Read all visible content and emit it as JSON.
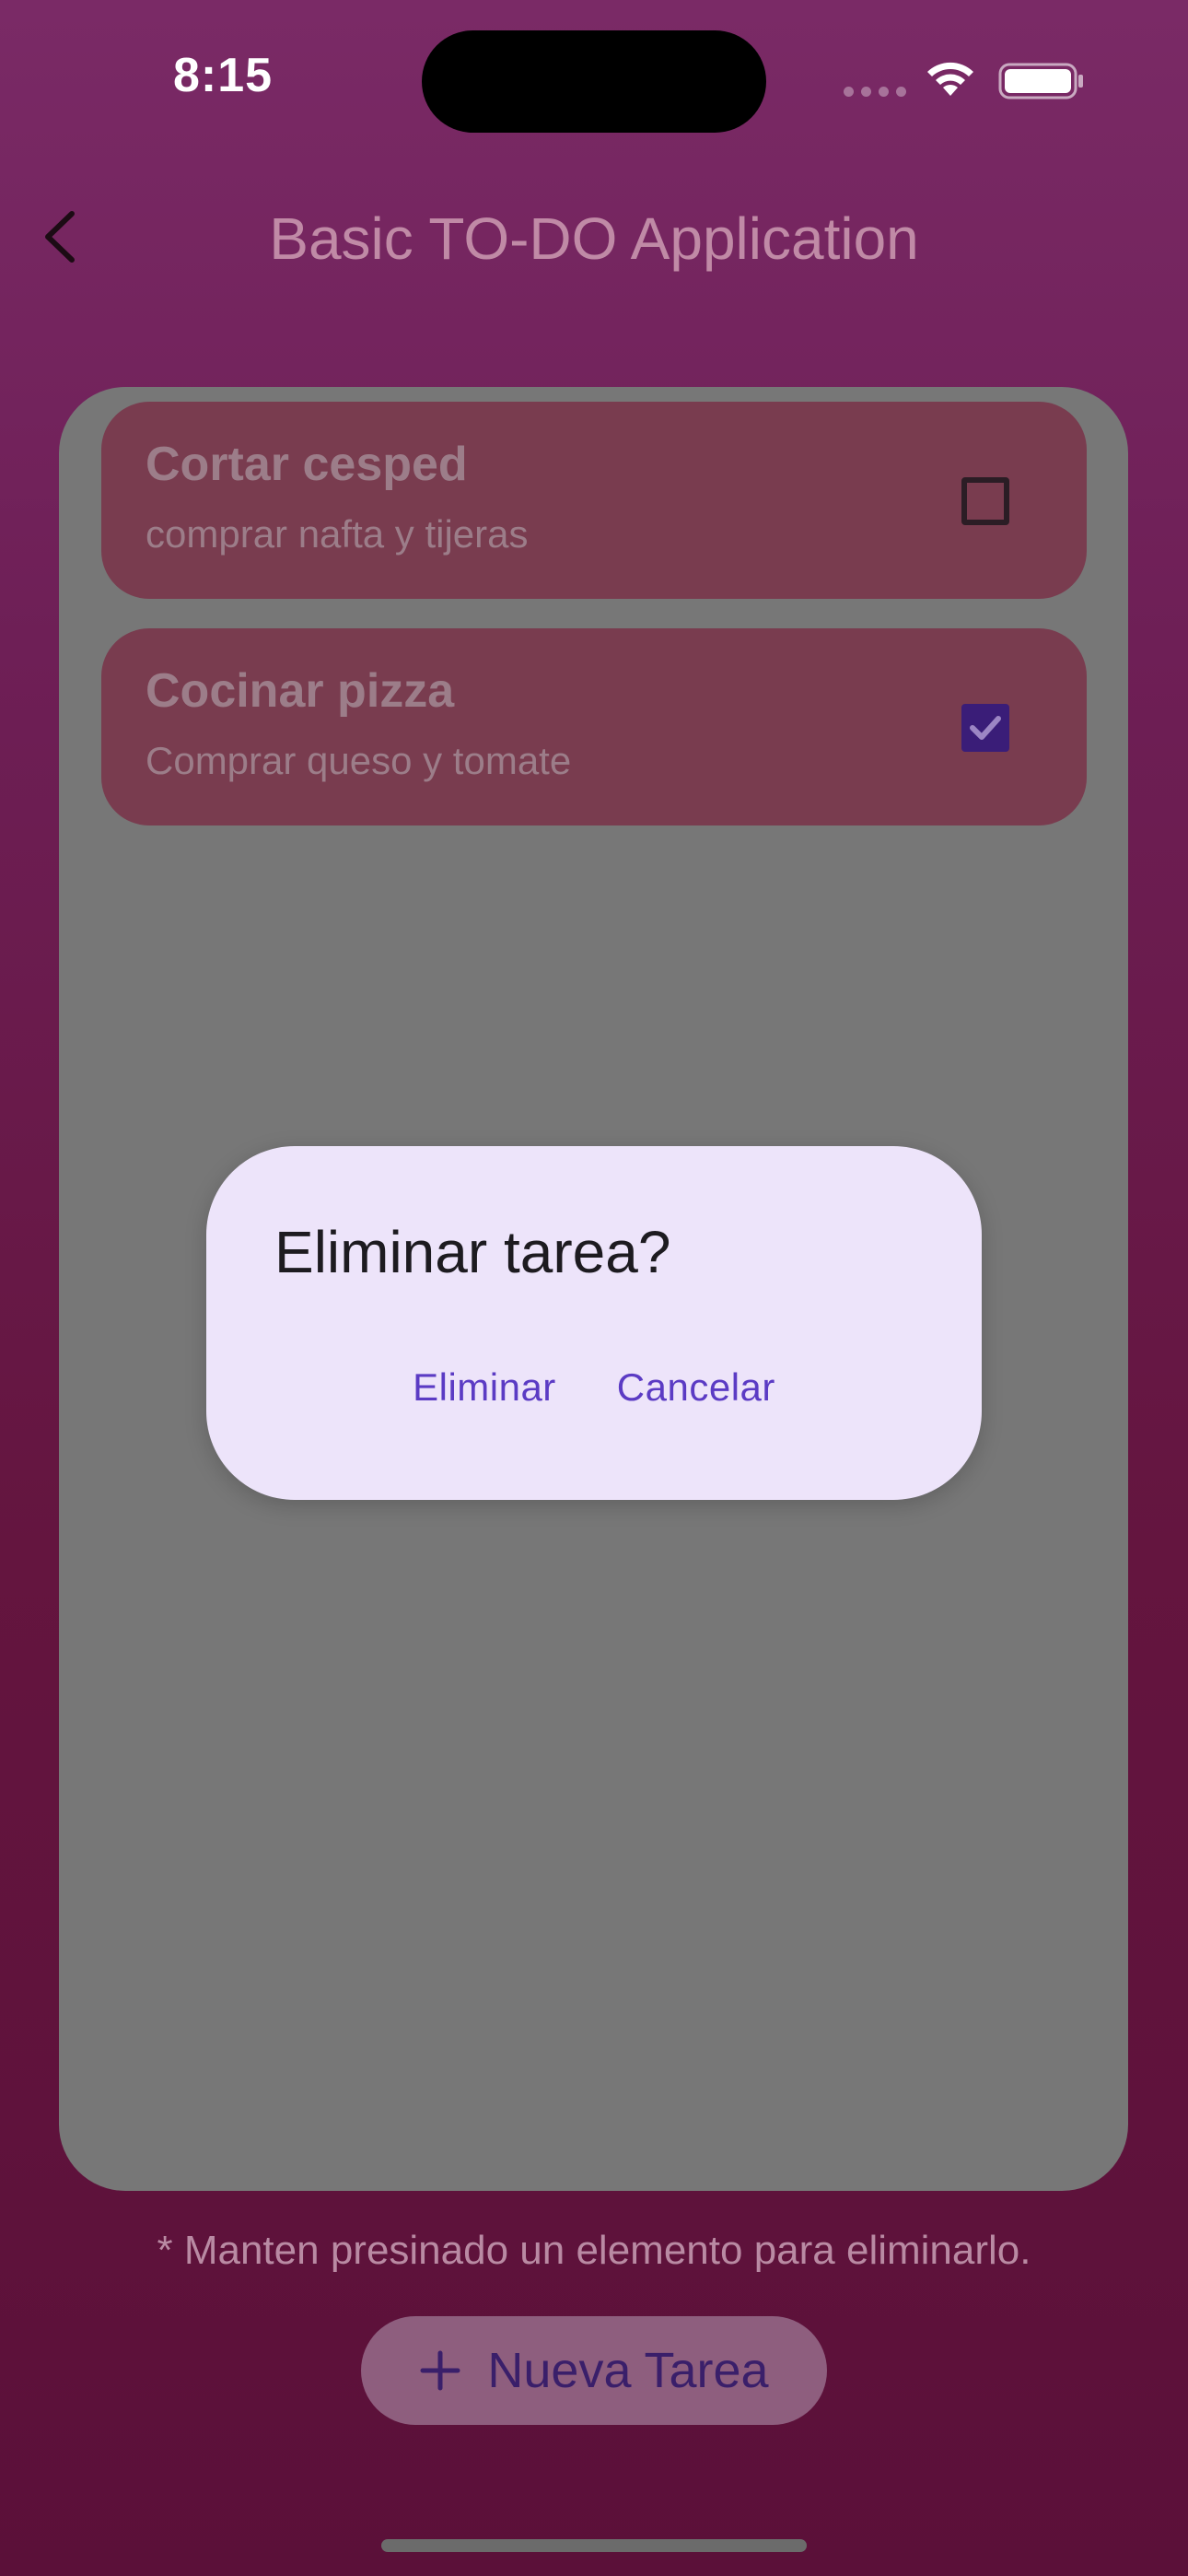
{
  "status_bar": {
    "time": "8:15"
  },
  "app_bar": {
    "title": "Basic TO-DO Application",
    "back_icon": "chevron-left-icon"
  },
  "tasks": [
    {
      "title": "Cortar cesped",
      "description": "comprar nafta y tijeras",
      "done": false
    },
    {
      "title": "Cocinar pizza",
      "description": "Comprar queso y tomate",
      "done": true
    }
  ],
  "hint": "* Manten presinado un elemento para eliminarlo.",
  "fab": {
    "label": "Nueva Tarea",
    "icon": "plus-icon"
  },
  "dialog": {
    "title": "Eliminar tarea?",
    "confirm_label": "Eliminar",
    "cancel_label": "Cancelar"
  },
  "colors": {
    "accent": "#5b3bc4",
    "dialog_bg": "#ede4fa",
    "checkbox_checked": "#3a1d78"
  }
}
